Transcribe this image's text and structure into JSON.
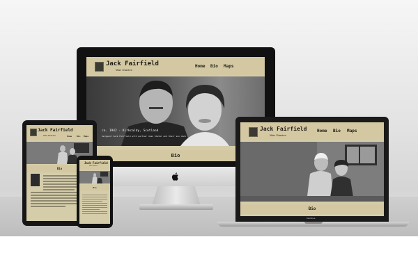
{
  "site": {
    "title": "Jack Fairfield",
    "subtitle": "War Diaries",
    "nav": [
      "Home",
      "Bio",
      "Maps"
    ]
  },
  "hero": {
    "imac_caption_line1": "ca. 1942 - Kirkcaldy, Scotland",
    "imac_caption_line2": "Sergeant Jack Fairfield with partner Joan Slater and their son Jack"
  },
  "sections": {
    "imac_label": "Bio",
    "laptop_label": "Bio",
    "tablet_label": "Bio",
    "phone_label": "Bio"
  },
  "laptop": {
    "brand": "MacBook"
  },
  "colors": {
    "page_bg": "#d5ccaa",
    "header_bg": "#d3c8a2",
    "text": "#1e1c15"
  }
}
